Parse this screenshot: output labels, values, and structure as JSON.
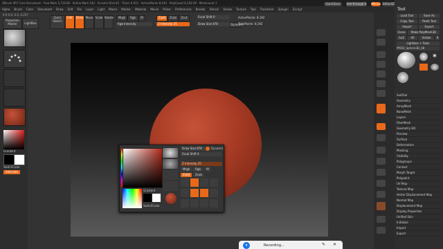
{
  "titlebar": "ZBrush 4R7 Core Document · Free Mem 5,721GB · Active Mem 542 · Scratch Disk 81 · Timer 0.011 · ActivePoints 8,192 · PolyCount 8,192 KP · Meshcount 1",
  "menu": [
    "Alpha",
    "Brush",
    "Color",
    "Document",
    "Draw",
    "Edit",
    "File",
    "Layer",
    "Light",
    "Macro",
    "Marker",
    "Material",
    "Movie",
    "Picker",
    "Preferences",
    "Render",
    "Stencil",
    "Stroke",
    "Texture",
    "Tool",
    "Transform",
    "Zplugin",
    "Zscript"
  ],
  "top_right": {
    "quicksave": "QuickSave",
    "see_through": "See-through 0",
    "menus": "Menus",
    "default_script": "DefaultZScript"
  },
  "coords": "0.0 0.0, 0.0, 0.257",
  "shelf": {
    "projection_master": "Projection Master",
    "lightbox": "LightBox",
    "quick_sketch": "Quick Sketch",
    "edit": "Edit",
    "draw": "Draw",
    "move": "Move",
    "scale": "Scale",
    "rotate": "Rotate",
    "mrgb": "Mrgb",
    "rgb": "Rgb",
    "m": "M",
    "zadd": "Zadd",
    "zsub": "Zsub",
    "zcut": "Zcut",
    "rgb_intensity": "Rgb Intensity",
    "z_intensity": "Z Intensity 25",
    "focal_shift": "Focal Shift 0",
    "draw_size": "Draw Size 878",
    "dynamic": "Dynamic",
    "active_points": "ActivePoints: 8,192",
    "total_points": "TotalPoints: 8,192"
  },
  "left": {
    "gradient": "Gradient",
    "switch_color": "SwitchColor",
    "alternate": "Alternate"
  },
  "popup": {
    "draw_size": "Draw Size 878",
    "dynamic": "Dynamic",
    "focal_shift": "Focal Shift 0",
    "z_intensity": "Z Intensity 25",
    "mrgb": "Mrgb",
    "rgb": "Rgb",
    "m": "M",
    "zadd": "Zadd",
    "zsub": "Zsub",
    "gradient": "Gradient",
    "switch_color": "SwitchColor"
  },
  "tray": {
    "title": "Tool",
    "buttons": [
      "Load Tool",
      "Save As",
      "Copy Tool",
      "Paste Tool",
      "Import",
      "Export",
      "Clone",
      "Make PolyMesh3D",
      "GoZ",
      "All",
      "Visible",
      "R",
      "Lightbox > Tools"
    ],
    "current_tool": "PM3D_Sphere3D_48",
    "tools": [
      "PM3D_Sphere3D",
      "SimpleBrush",
      "EraserBrush",
      "Sphere3D"
    ],
    "subpanels": [
      "SubTool",
      "Geometry",
      "ArrayMesh",
      "NanoMesh",
      "Layers",
      "FiberMesh",
      "Geometry HD",
      "Preview",
      "Surface",
      "Deformation",
      "Masking",
      "Visibility",
      "Polygroups",
      "Contact",
      "Morph Target",
      "Polypaint",
      "UV Map",
      "Texture Map",
      "Vector Displacement Map",
      "Normal Map",
      "Displacement Map",
      "Display Properties",
      "Unified Skin",
      "Initialize",
      "Import",
      "Export"
    ]
  },
  "recording": "Recording..."
}
